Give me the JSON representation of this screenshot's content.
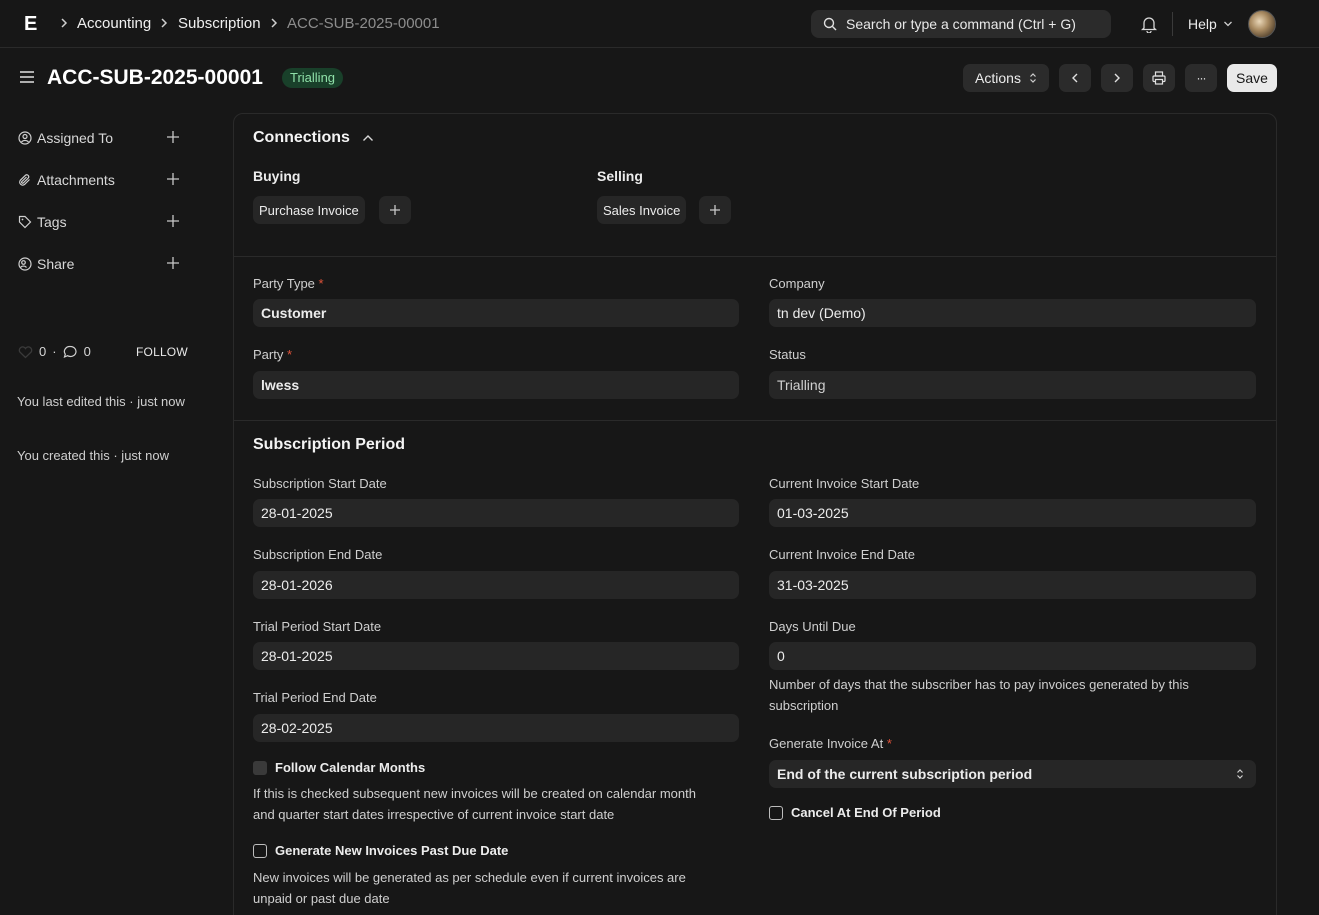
{
  "navbar": {
    "logo": "E",
    "breadcrumbs": [
      "Accounting",
      "Subscription",
      "ACC-SUB-2025-00001"
    ],
    "search_placeholder": "Search or type a command (Ctrl + G)",
    "help_label": "Help"
  },
  "page": {
    "title": "ACC-SUB-2025-00001",
    "status_badge": "Trialling",
    "actions_label": "Actions",
    "save_label": "Save",
    "more_label": "···"
  },
  "sidebar": {
    "items": [
      {
        "label": "Assigned To",
        "icon": "assign-icon"
      },
      {
        "label": "Attachments",
        "icon": "paperclip-icon"
      },
      {
        "label": "Tags",
        "icon": "tag-icon"
      },
      {
        "label": "Share",
        "icon": "share-icon"
      }
    ],
    "likes": "0",
    "comments": "0",
    "follow_label": "FOLLOW",
    "last_edited": "You last edited this · just now",
    "created": "You created this · just now"
  },
  "connections": {
    "title": "Connections",
    "buying": {
      "heading": "Buying",
      "item": "Purchase Invoice"
    },
    "selling": {
      "heading": "Selling",
      "item": "Sales Invoice"
    }
  },
  "details": {
    "party_type": {
      "label": "Party Type",
      "value": "Customer"
    },
    "company": {
      "label": "Company",
      "value": "tn dev (Demo)"
    },
    "party": {
      "label": "Party",
      "value": "lwess"
    },
    "status": {
      "label": "Status",
      "value": "Trialling"
    },
    "required_mark": "*"
  },
  "period": {
    "title": "Subscription Period",
    "sub_start": {
      "label": "Subscription Start Date",
      "value": "28-01-2025"
    },
    "sub_end": {
      "label": "Subscription End Date",
      "value": "28-01-2026"
    },
    "trial_start": {
      "label": "Trial Period Start Date",
      "value": "28-01-2025"
    },
    "trial_end": {
      "label": "Trial Period End Date",
      "value": "28-02-2025"
    },
    "follow_calendar": {
      "label": "Follow Calendar Months",
      "help_1": "If this is checked subsequent new invoices will be created on calendar month",
      "help_2": "and quarter start dates irrespective of current invoice start date"
    },
    "generate_past_due": {
      "label": "Generate New Invoices Past Due Date",
      "help_1": "New invoices will be generated as per schedule even if current invoices are",
      "help_2": "unpaid or past due date"
    },
    "inv_start": {
      "label": "Current Invoice Start Date",
      "value": "01-03-2025"
    },
    "inv_end": {
      "label": "Current Invoice End Date",
      "value": "31-03-2025"
    },
    "days_due": {
      "label": "Days Until Due",
      "value": "0",
      "help_1": "Number of days that the subscriber has to pay invoices generated by this",
      "help_2": "subscription"
    },
    "generate_at": {
      "label": "Generate Invoice At",
      "value": "End of the current subscription period"
    },
    "cancel_end": {
      "label": "Cancel At End Of Period"
    }
  }
}
